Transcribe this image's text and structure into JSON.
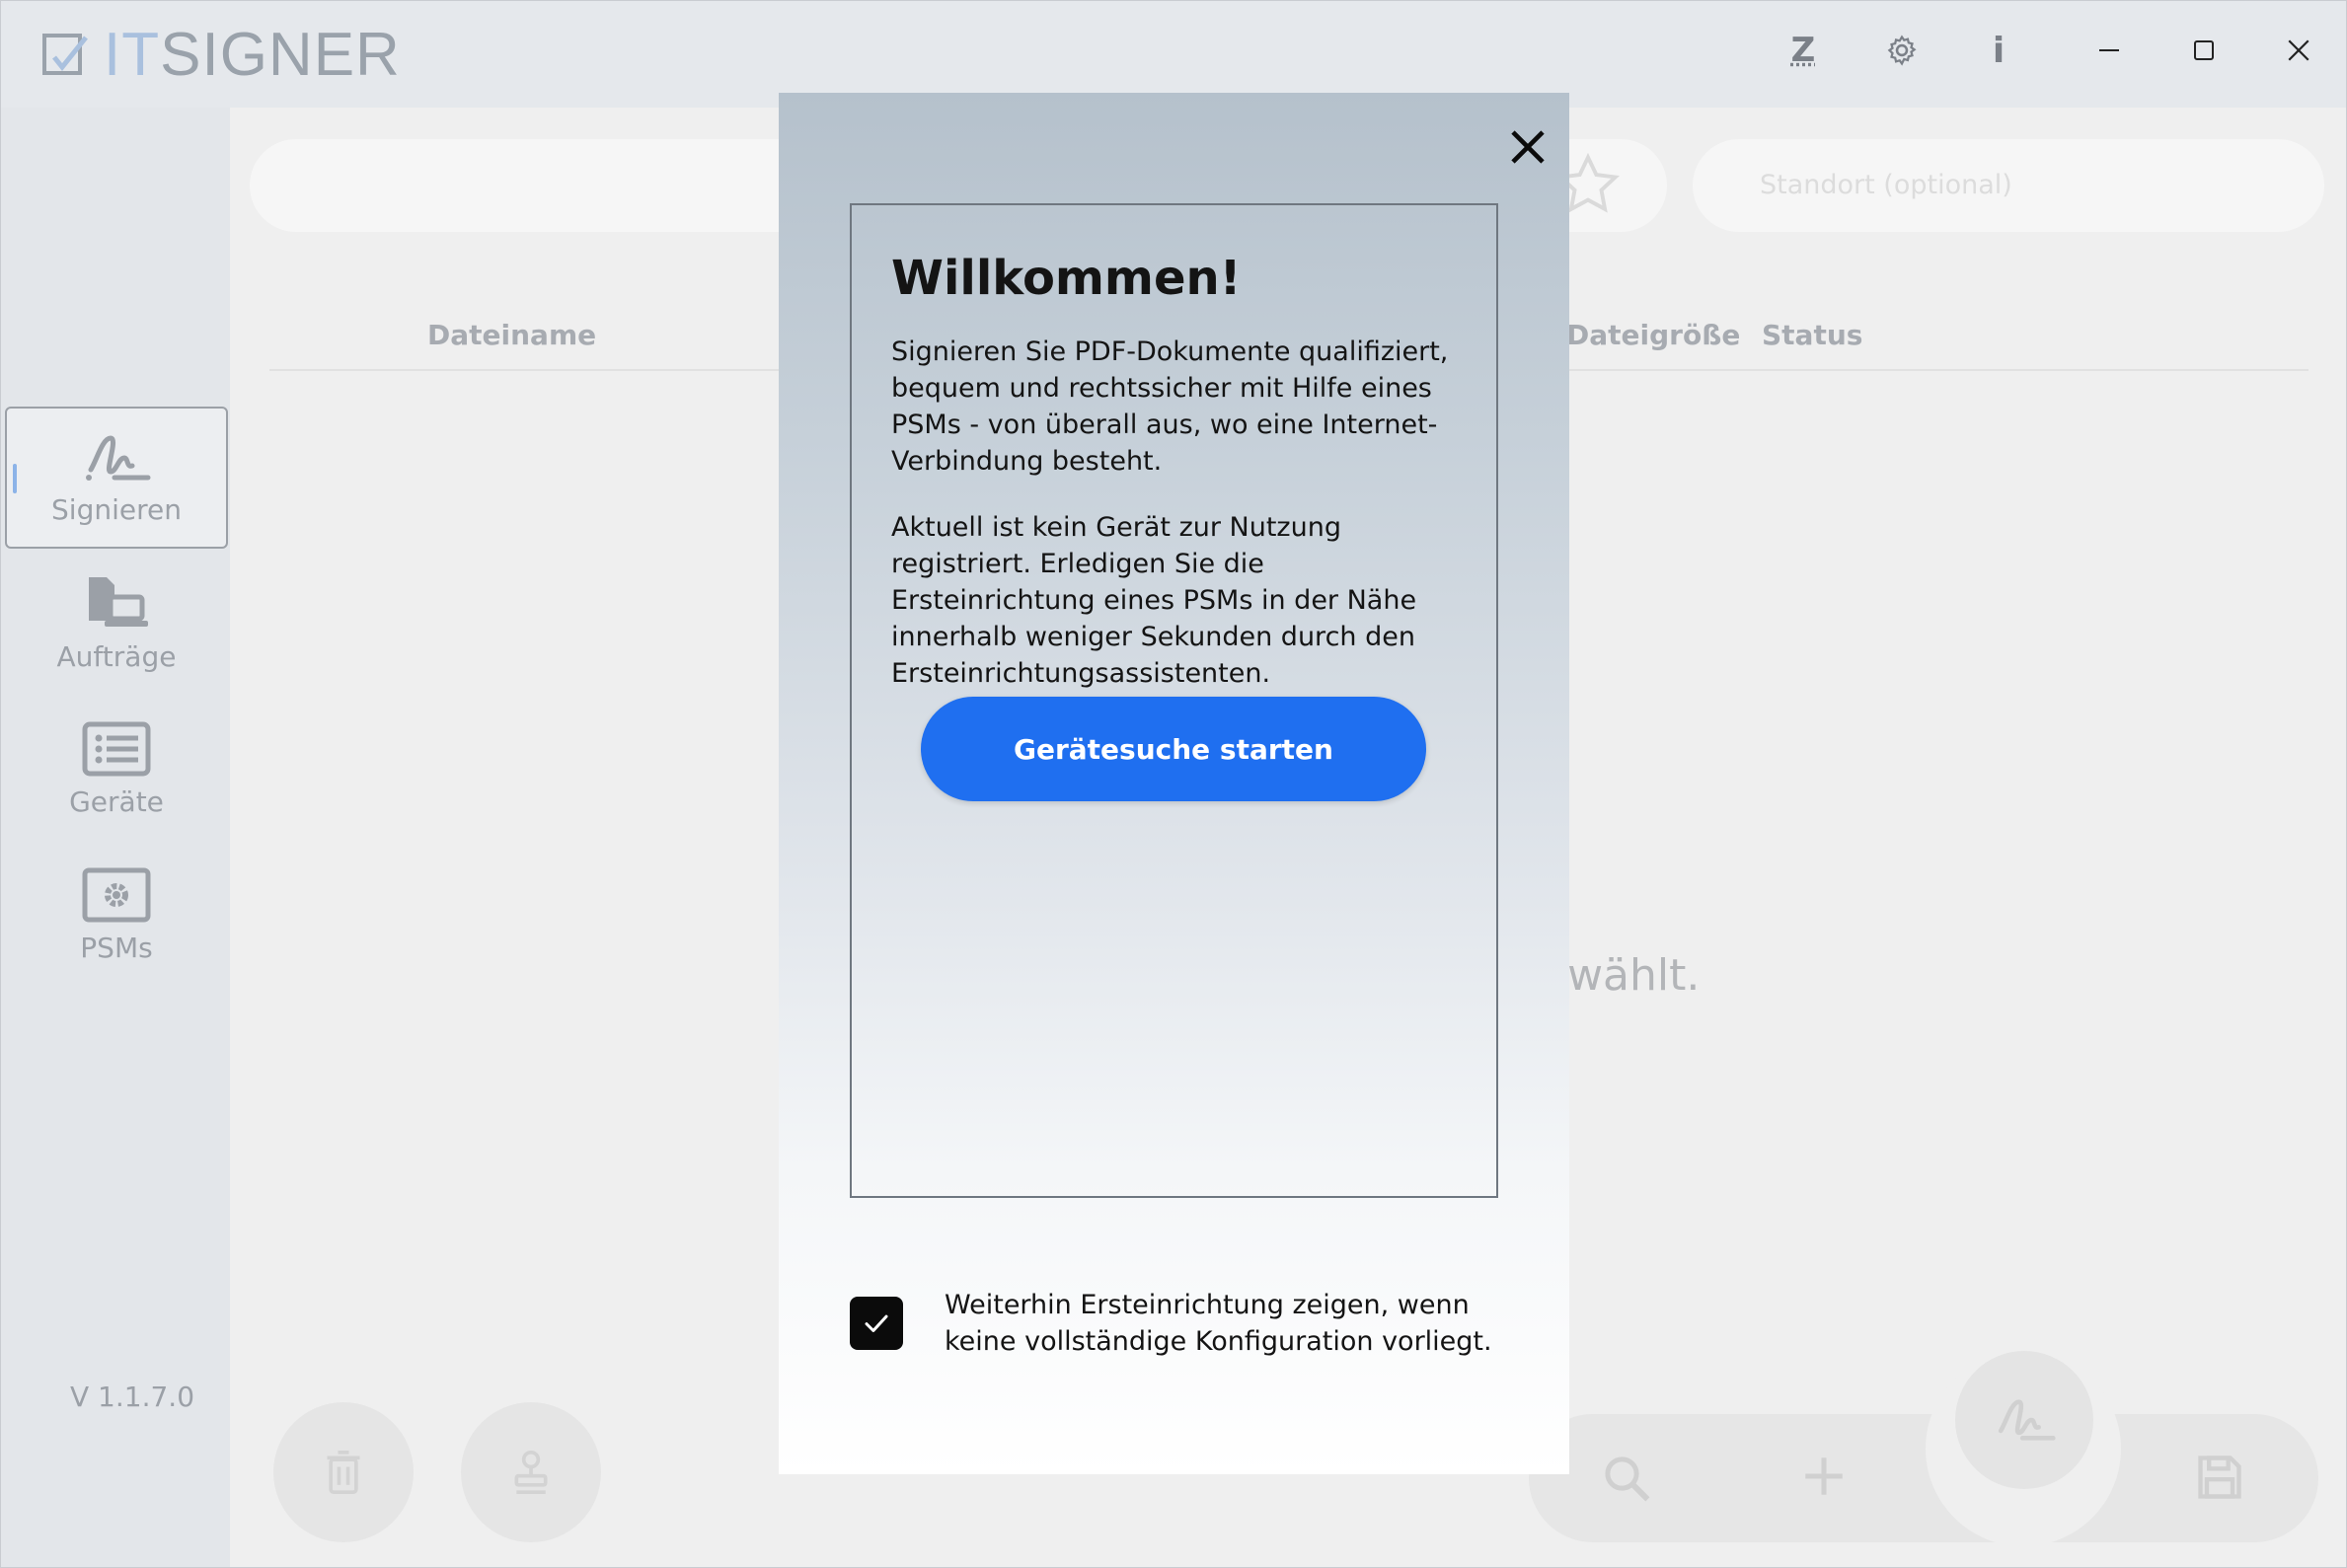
{
  "app": {
    "logo_prefix": "IT",
    "logo_suffix": "SIGNER",
    "version": "V 1.1.7.0",
    "accent": "#1f6ff0"
  },
  "titlebar": {
    "z_label": "Z",
    "info_label": "i",
    "icons": [
      "gear-icon",
      "minimize-icon",
      "maximize-icon",
      "close-icon"
    ]
  },
  "sidebar": {
    "items": [
      {
        "label": "Signieren",
        "icon": "signature-icon",
        "active": true
      },
      {
        "label": "Aufträge",
        "icon": "orders-icon",
        "active": false
      },
      {
        "label": "Geräte",
        "icon": "devices-list-icon",
        "active": false
      },
      {
        "label": "PSMs",
        "icon": "psm-settings-icon",
        "active": false
      }
    ]
  },
  "main": {
    "location_placeholder": "Standort (optional)",
    "columns": {
      "filename": "Dateiname",
      "filesize": "Dateigröße",
      "status": "Status"
    },
    "empty_text_visible": "ewählt."
  },
  "modal": {
    "title": "Willkommen!",
    "paragraph1": "Signieren Sie PDF-Dokumente qualifiziert, bequem und rechtssicher mit Hilfe eines PSMs - von überall aus, wo eine Internet-Verbindung besteht.",
    "paragraph2": "Aktuell ist kein Gerät zur Nutzung registriert. Erledigen Sie die Ersteinrichtung eines PSMs in der Nähe innerhalb weniger Sekunden durch den Ersteinrichtungsassistenten.",
    "primary_button": "Gerätesuche starten",
    "checkbox_label": "Weiterhin Ersteinrichtung zeigen, wenn keine vollständige Konfiguration vorliegt.",
    "checkbox_checked": true
  }
}
